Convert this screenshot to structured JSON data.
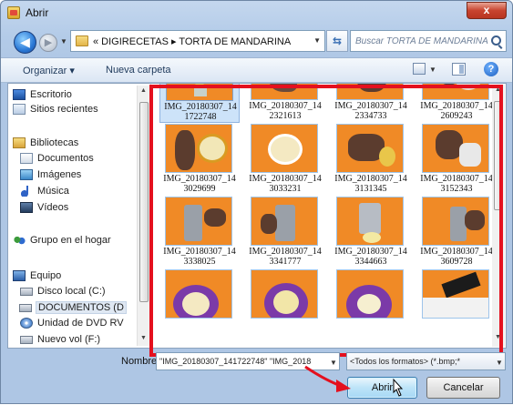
{
  "window": {
    "title": "Abrir",
    "close_label": "x"
  },
  "nav": {
    "back_label": "◀",
    "forward_label": "▶",
    "breadcrumb": "« DIGIRECETAS ▸ TORTA DE MANDARINA",
    "search_placeholder": "Buscar TORTA DE MANDARINA"
  },
  "toolbar": {
    "organize": "Organizar ▾",
    "new_folder": "Nueva carpeta",
    "help": "?"
  },
  "sidebar": {
    "items": [
      {
        "label": "Escritorio",
        "icon": "desktop-icon"
      },
      {
        "label": "Sitios recientes",
        "icon": "recent-places-icon"
      },
      {
        "label": "Bibliotecas",
        "icon": "libraries-icon"
      },
      {
        "label": "Documentos",
        "icon": "documents-icon"
      },
      {
        "label": "Imágenes",
        "icon": "images-icon"
      },
      {
        "label": "Música",
        "icon": "music-icon"
      },
      {
        "label": "Vídeos",
        "icon": "videos-icon"
      },
      {
        "label": "Grupo en el hogar",
        "icon": "homegroup-icon"
      },
      {
        "label": "Equipo",
        "icon": "computer-icon"
      },
      {
        "label": "Disco local (C:)",
        "icon": "drive-icon"
      },
      {
        "label": "DOCUMENTOS (D",
        "icon": "drive-icon"
      },
      {
        "label": "Unidad de DVD RV",
        "icon": "dvd-icon"
      },
      {
        "label": "Nuevo vol (F:)",
        "icon": "drive-icon"
      }
    ]
  },
  "files": [
    {
      "name": "IMG_20180307_14\n1722748"
    },
    {
      "name": "IMG_20180307_14\n2321613"
    },
    {
      "name": "IMG_20180307_14\n2334733"
    },
    {
      "name": "IMG_20180307_14\n2609243"
    },
    {
      "name": "IMG_20180307_14\n3029699"
    },
    {
      "name": "IMG_20180307_14\n3033231"
    },
    {
      "name": "IMG_20180307_14\n3131345"
    },
    {
      "name": "IMG_20180307_14\n3152343"
    },
    {
      "name": "IMG_20180307_14\n3338025"
    },
    {
      "name": "IMG_20180307_14\n3341777"
    },
    {
      "name": "IMG_20180307_14\n3344663"
    },
    {
      "name": "IMG_20180307_14\n3609728"
    },
    {
      "name": ""
    },
    {
      "name": ""
    },
    {
      "name": ""
    },
    {
      "name": ""
    }
  ],
  "bottom": {
    "name_label": "Nombre:",
    "name_value": "\"IMG_20180307_141722748\" \"IMG_2018",
    "filter_value": "<Todos los formatos> (*.bmp;*",
    "open_label": "Abrir",
    "cancel_label": "Cancelar"
  },
  "colors": {
    "highlight_frame": "#e4101e",
    "thumbnail_bg": "#f08a26",
    "selection": "#cde3f9"
  }
}
